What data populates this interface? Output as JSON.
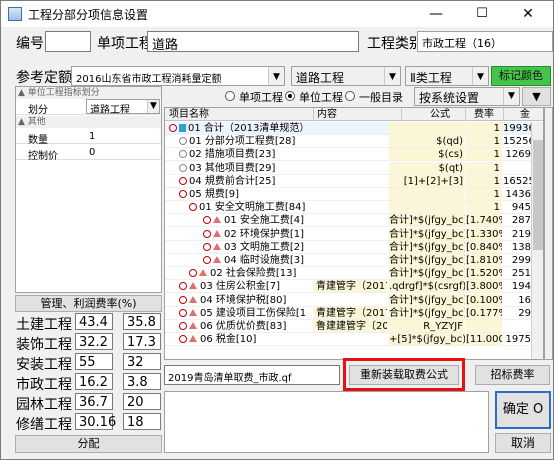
{
  "window": {
    "title": "工程分部分项信息设置"
  },
  "top": {
    "code_label": "编号",
    "code_value": "",
    "project_label": "单项工程",
    "project_value": "道路",
    "category_label": "工程类别",
    "category_value": "市政工程（16）"
  },
  "quota": {
    "label": "参考定额",
    "value": "2016山东省市政工程消耗量定额",
    "road_value": "道路工程",
    "class_value": "Ⅱ类工程",
    "color_button": "标记颜色"
  },
  "left_props": {
    "group1": "单位工程指标划分",
    "rows1": [
      {
        "k": "划分",
        "v": "道路工程"
      }
    ],
    "group2": "其他",
    "rows2": [
      {
        "k": "数量",
        "v": "1"
      },
      {
        "k": "控制价",
        "v": "0"
      }
    ]
  },
  "rates": {
    "header": "管理、利润费率(%)",
    "rows": [
      {
        "name": "土建工程",
        "a": "43.4",
        "b": "35.8"
      },
      {
        "name": "装饰工程",
        "a": "32.2",
        "b": "17.3"
      },
      {
        "name": "安装工程",
        "a": "55",
        "b": "32"
      },
      {
        "name": "市政工程",
        "a": "16.2",
        "b": "3.8"
      },
      {
        "name": "园林工程",
        "a": "36.7",
        "b": "20"
      },
      {
        "name": "修缮工程",
        "a": "30.16",
        "b": "18"
      }
    ],
    "distribute_button": "分配"
  },
  "modes": {
    "options": [
      "单项工程",
      "单位工程",
      "一般目录"
    ],
    "selected": 1,
    "settings_value": "按系统设置"
  },
  "grid": {
    "headers": [
      "项目名称",
      "内容",
      "公式",
      "费率",
      "金"
    ],
    "rows": [
      {
        "name": "01 合计（2013清单规范）",
        "content": "",
        "formula": "",
        "rate": "1",
        "amount": "19936"
      },
      {
        "name": "01 分部分项工程费[28]",
        "content": "",
        "formula": "$(qd)",
        "rate": "1",
        "amount": "15256"
      },
      {
        "name": "02 措施项目费[23]",
        "content": "",
        "formula": "$(cs)",
        "rate": "1",
        "amount": "1269"
      },
      {
        "name": "03 其他项目费[29]",
        "content": "",
        "formula": "$(qt)",
        "rate": "1",
        "amount": ""
      },
      {
        "name": "04 規费前合计[25]",
        "content": "",
        "formula": "[1]+[2]+[3]",
        "rate": "1",
        "amount": "16525"
      },
      {
        "name": "05 規费[9]",
        "content": "",
        "formula": "",
        "rate": "1",
        "amount": "1436"
      },
      {
        "name": "01 安全文明施工费[84]",
        "content": "",
        "formula": "",
        "rate": "1",
        "amount": "945"
      },
      {
        "name": "01 安全施工费[4]",
        "content": "",
        "formula": "合计]*$(jfgy_bc)",
        "rate": "[1.740%]",
        "amount": "287"
      },
      {
        "name": "02 环境保护费[1]",
        "content": "",
        "formula": "合计]*$(jfgy_bc)",
        "rate": "[1.330%]",
        "amount": "219"
      },
      {
        "name": "03 文明施工费[2]",
        "content": "",
        "formula": "合计]*$(jfgy_bc)",
        "rate": "[0.840%]",
        "amount": "138"
      },
      {
        "name": "04 临时设施费[3]",
        "content": "",
        "formula": "合计]*$(jfgy_bc)",
        "rate": "[1.810%]",
        "amount": "299"
      },
      {
        "name": "02 社会保险费[13]",
        "content": "",
        "formula": "合计]*$(jfgy_bc)",
        "rate": "[1.520%]",
        "amount": "251"
      },
      {
        "name": "03 住房公积金[7]",
        "content": "青建管字（2017）",
        "formula": ".qdrgf]*$(csrgf)",
        "rate": "[3.800%]",
        "amount": "194"
      },
      {
        "name": "04 环境保护税[80]",
        "content": "",
        "formula": "合计]*$(jfgy_bc)",
        "rate": "[0.100%]",
        "amount": "16"
      },
      {
        "name": "05 建设项目工伤保险[1",
        "content": "青建管字（2017）",
        "formula": "合计]*$(jfgy_bc)",
        "rate": "[0.177%]",
        "amount": "29"
      },
      {
        "name": "06 优质优价费[83]",
        "content": "鲁建建管字〔2019",
        "formula": "R_YZYJF",
        "rate": "",
        "amount": ""
      },
      {
        "name": "06 税金[10]",
        "content": "",
        "formula": "+[5]*$(jfgy_bc)",
        "rate": "[11.000%]",
        "amount": "1975"
      }
    ]
  },
  "bottom": {
    "file_value": "2019青岛清单取费_市政.qf",
    "reload_button": "重新装载取费公式",
    "bid_rate_button": "招标费率",
    "ok_button": "确定 O",
    "cancel_button": "取消"
  }
}
